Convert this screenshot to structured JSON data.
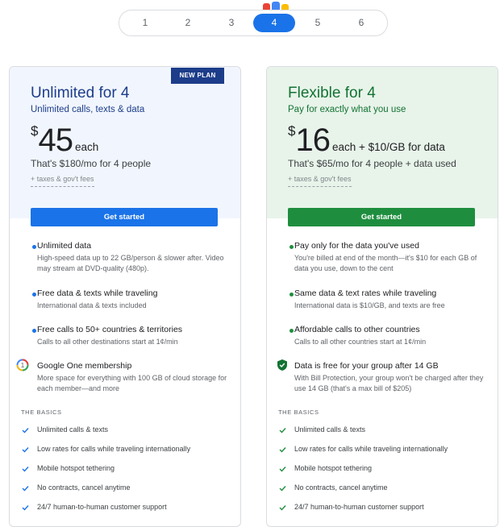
{
  "selector": {
    "options": [
      "1",
      "2",
      "3",
      "4",
      "5",
      "6"
    ],
    "selected": "4"
  },
  "colors": {
    "blue": "#1a73e8",
    "navy": "#1d3d8a",
    "green": "#1e8e3e",
    "dark_green": "#137333"
  },
  "plans": {
    "unlimited": {
      "badge": "NEW PLAN",
      "title": "Unlimited for 4",
      "subtitle": "Unlimited calls, texts & data",
      "currency": "$",
      "price": "45",
      "price_unit": "each",
      "price_note": "That's $180/mo for 4 people",
      "tax_note": "+ taxes & gov't fees",
      "cta": "Get started",
      "features": [
        {
          "icon": "bullet-dot",
          "title": "Unlimited data",
          "desc": "High-speed data up to 22 GB/person & slower after. Video may stream at DVD-quality (480p)."
        },
        {
          "icon": "bullet-dot",
          "title": "Free data & texts while traveling",
          "desc": "International data & texts included"
        },
        {
          "icon": "bullet-dot",
          "title": "Free calls to 50+ countries & territories",
          "desc": "Calls to all other destinations start at 1¢/min"
        },
        {
          "icon": "google-one-icon",
          "title": "Google One membership",
          "desc": "More space for everything with 100 GB of cloud storage for each member—and more"
        }
      ],
      "basics_label": "THE BASICS",
      "basics": [
        "Unlimited calls & texts",
        "Low rates for calls while traveling internationally",
        "Mobile hotspot tethering",
        "No contracts, cancel anytime",
        "24/7 human-to-human customer support"
      ]
    },
    "flexible": {
      "title": "Flexible for 4",
      "subtitle": "Pay for exactly what you use",
      "currency": "$",
      "price": "16",
      "price_unit": "each + $10/GB for data",
      "price_note": "That's $65/mo for 4 people + data used",
      "tax_note": "+ taxes & gov't fees",
      "cta": "Get started",
      "features": [
        {
          "icon": "bullet-dot",
          "title": "Pay only for the data you've used",
          "desc": "You're billed at end of the month—it's $10 for each GB of data you use, down to the cent"
        },
        {
          "icon": "bullet-dot",
          "title": "Same data & text rates while traveling",
          "desc": "International data is $10/GB, and texts are free"
        },
        {
          "icon": "bullet-dot",
          "title": "Affordable calls to other countries",
          "desc": "Calls to all other countries start at 1¢/min"
        },
        {
          "icon": "shield-check-icon",
          "title": "Data is free for your group after 14 GB",
          "desc": "With Bill Protection, your group won't be charged after they use 14 GB (that's a max bill of $205)"
        }
      ],
      "basics_label": "THE BASICS",
      "basics": [
        "Unlimited calls & texts",
        "Low rates for calls while traveling internationally",
        "Mobile hotspot tethering",
        "No contracts, cancel anytime",
        "24/7 human-to-human customer support"
      ]
    }
  }
}
